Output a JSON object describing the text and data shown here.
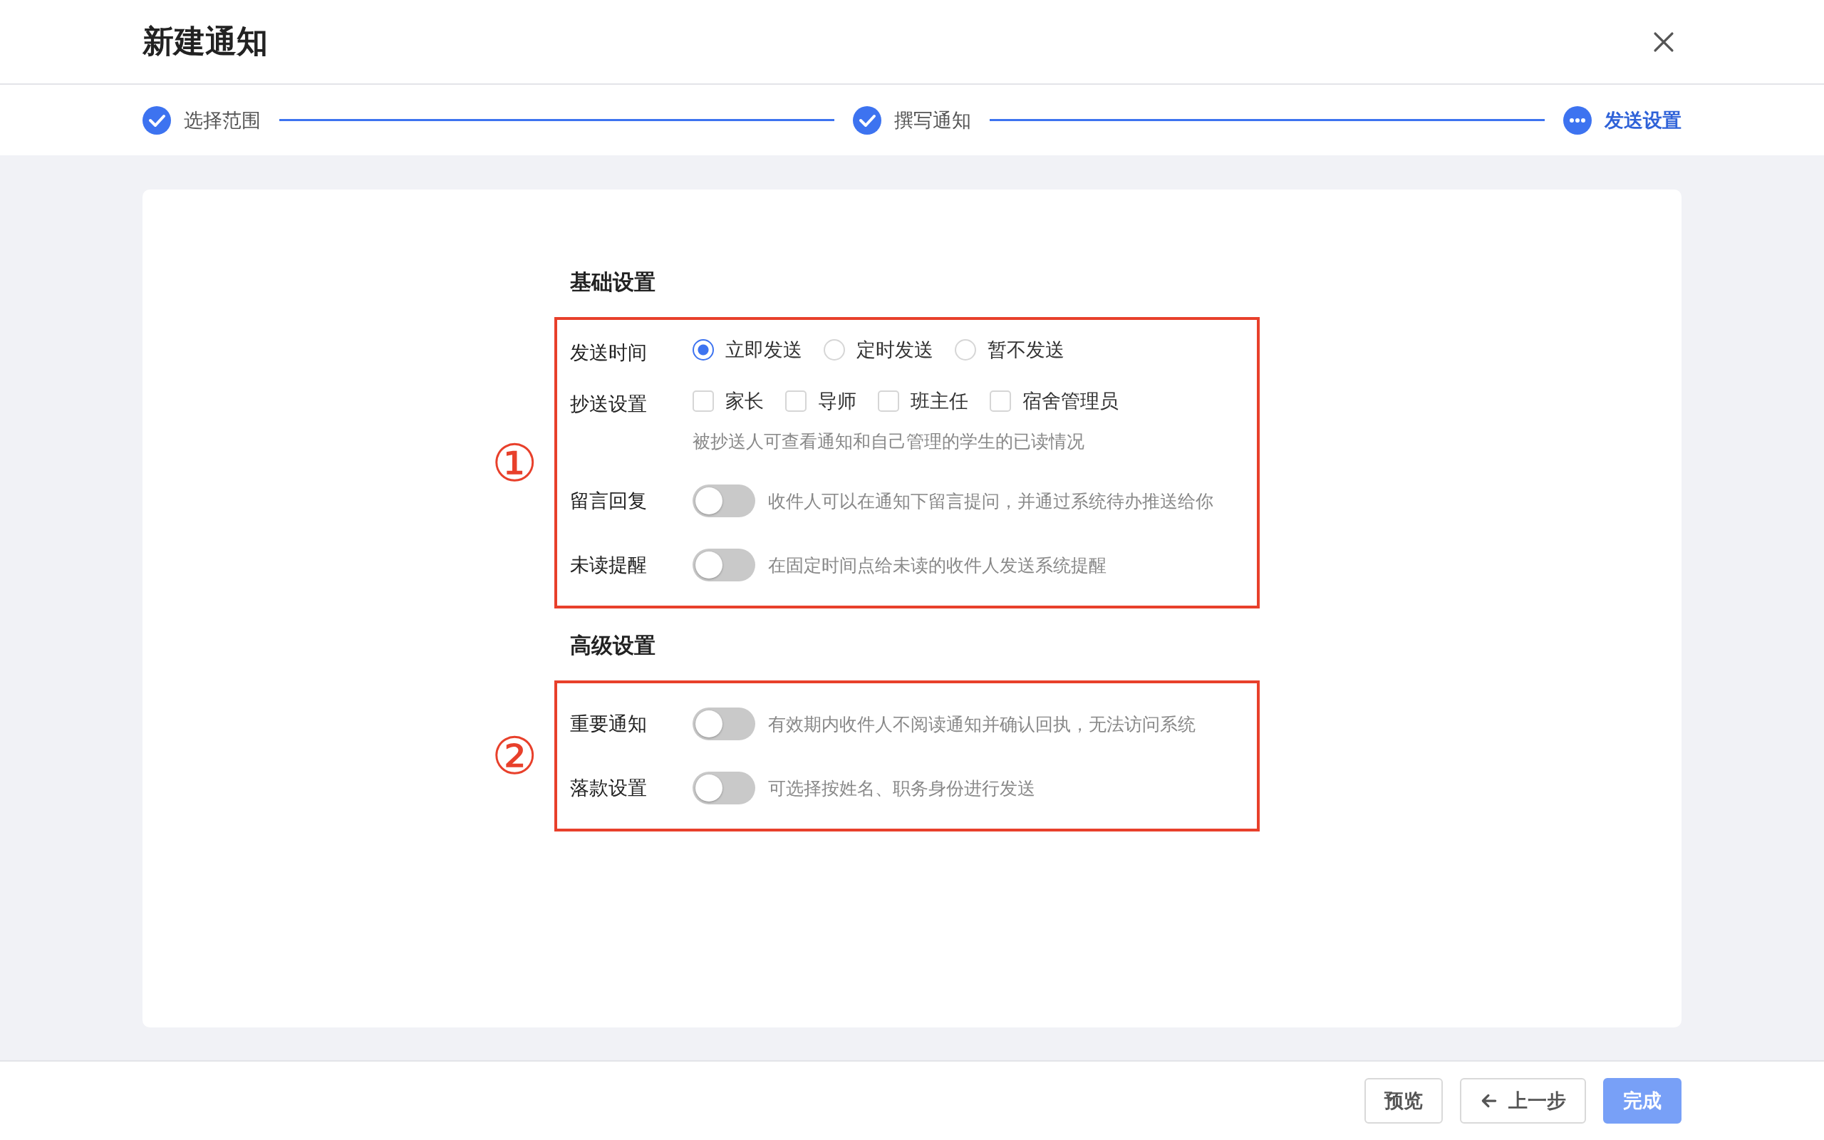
{
  "dialog": {
    "title": "新建通知"
  },
  "steps": [
    {
      "label": "选择范围",
      "done": true,
      "selected": false
    },
    {
      "label": "撰写通知",
      "done": true,
      "selected": false
    },
    {
      "label": "发送设置",
      "done": false,
      "selected": true
    }
  ],
  "sections": [
    {
      "title": "基础设置",
      "marker": "①",
      "rows": [
        {
          "kind": "radio",
          "label": "发送时间",
          "options": [
            {
              "label": "立即发送",
              "selected": true
            },
            {
              "label": "定时发送",
              "selected": false
            },
            {
              "label": "暂不发送",
              "selected": false
            }
          ]
        },
        {
          "kind": "checkbox",
          "label": "抄送设置",
          "options": [
            {
              "label": "家长",
              "checked": false
            },
            {
              "label": "导师",
              "checked": false
            },
            {
              "label": "班主任",
              "checked": false
            },
            {
              "label": "宿舍管理员",
              "checked": false
            }
          ],
          "hint": "被抄送人可查看通知和自己管理的学生的已读情况"
        },
        {
          "kind": "toggle",
          "label": "留言回复",
          "on": false,
          "hint": "收件人可以在通知下留言提问，并通过系统待办推送给你"
        },
        {
          "kind": "toggle",
          "label": "未读提醒",
          "on": false,
          "hint": "在固定时间点给未读的收件人发送系统提醒"
        }
      ]
    },
    {
      "title": "高级设置",
      "marker": "②",
      "rows": [
        {
          "kind": "toggle",
          "label": "重要通知",
          "on": false,
          "hint": "有效期内收件人不阅读通知并确认回执，无法访问系统"
        },
        {
          "kind": "toggle",
          "label": "落款设置",
          "on": false,
          "hint": "可选择按姓名、职务身份进行发送"
        }
      ]
    }
  ],
  "buttons": [
    {
      "label": "预览",
      "kind": "default"
    },
    {
      "label": "上一步",
      "kind": "back"
    },
    {
      "label": "完成",
      "kind": "primary"
    }
  ]
}
